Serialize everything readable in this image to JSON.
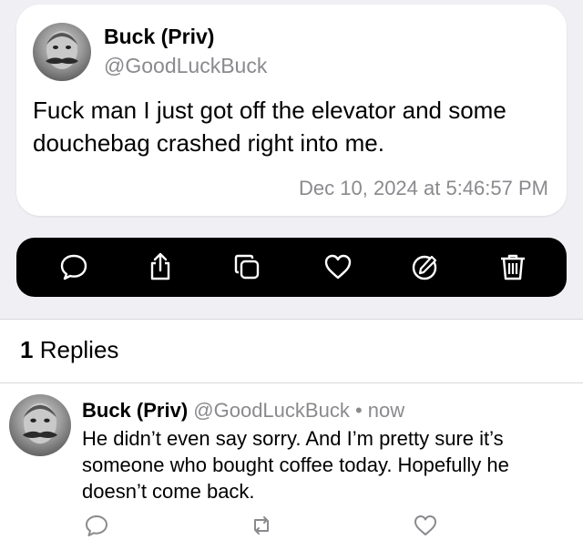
{
  "post": {
    "author_name": "Buck (Priv)",
    "author_handle": "@GoodLuckBuck",
    "text": "Fuck man I just got off the elevator and some douchebag crashed right into me.",
    "timestamp": "Dec 10, 2024 at 5:46:57 PM",
    "avatar_icon": "user-avatar-photo"
  },
  "toolbar": {
    "actions": [
      {
        "icon": "speech-bubble-icon",
        "action": "reply"
      },
      {
        "icon": "share-icon",
        "action": "share"
      },
      {
        "icon": "copy-icon",
        "action": "copy"
      },
      {
        "icon": "heart-icon",
        "action": "like"
      },
      {
        "icon": "edit-icon",
        "action": "edit"
      },
      {
        "icon": "trash-icon",
        "action": "delete"
      }
    ]
  },
  "replies": {
    "count": "1",
    "label": "Replies",
    "items": [
      {
        "author_name": "Buck (Priv)",
        "author_handle": "@GoodLuckBuck",
        "separator": "•",
        "time": "now",
        "text": "He didn’t even say sorry. And I’m pretty sure it’s someone who bought coffee today. Hopefully he doesn’t come back.",
        "actions": [
          "reply-icon",
          "repost-icon",
          "like-icon"
        ]
      }
    ]
  },
  "colors": {
    "background_top": "#efeff4",
    "card": "#ffffff",
    "toolbar": "#000000",
    "secondary_text": "#8a8a8e"
  }
}
